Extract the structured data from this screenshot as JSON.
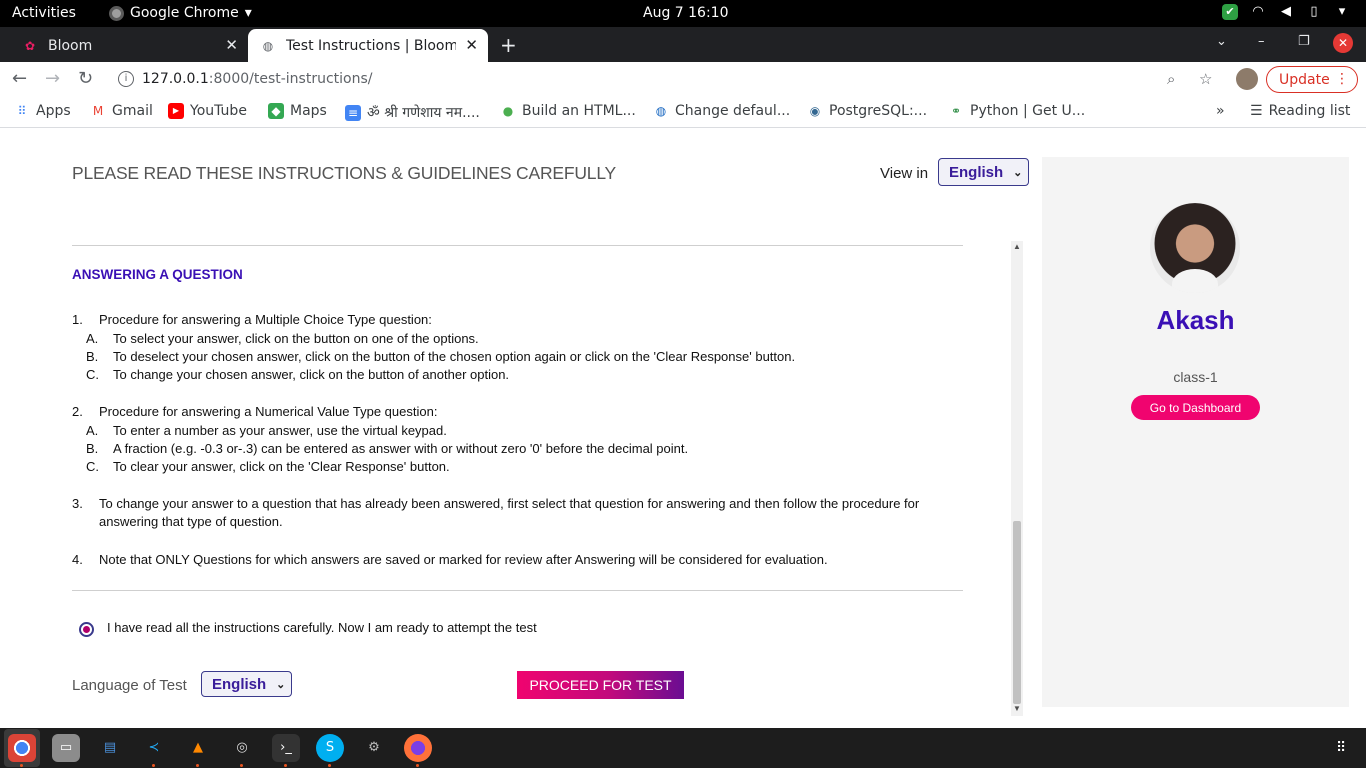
{
  "system": {
    "activities": "Activities",
    "app_name": "Google Chrome",
    "clock": "Aug 7  16:10"
  },
  "tabs": [
    {
      "title": "Bloom",
      "active": false
    },
    {
      "title": "Test Instructions | Bloom",
      "active": true
    }
  ],
  "address": {
    "host": "127.0.0.1",
    "path": ":8000/test-instructions/",
    "update_label": "Update"
  },
  "bookmarks": [
    {
      "label": "Apps",
      "icon": "apps-grid-icon"
    },
    {
      "label": "Gmail",
      "icon": "gmail-icon"
    },
    {
      "label": "YouTube",
      "icon": "youtube-icon"
    },
    {
      "label": "Maps",
      "icon": "maps-icon"
    },
    {
      "label": "ॐ श्री गणेशाय नम....",
      "icon": "docs-icon"
    },
    {
      "label": "Build an HTML...",
      "icon": "leaf-icon"
    },
    {
      "label": "Change defaul...",
      "icon": "globe-icon"
    },
    {
      "label": "PostgreSQL:...",
      "icon": "elephant-icon"
    },
    {
      "label": "Python | Get U...",
      "icon": "geeks-icon"
    }
  ],
  "reading_list": "Reading list",
  "page": {
    "heading": "PLEASE READ THESE INSTRUCTIONS & GUIDELINES CAREFULLY",
    "view_in_label": "View in",
    "view_in_value": "English",
    "section_title": "ANSWERING A QUESTION",
    "items": [
      {
        "num": "1.",
        "text": "Procedure for answering a Multiple Choice Type question:",
        "subs": [
          {
            "letter": "A.",
            "text": "To select your answer, click on the button on one of the options."
          },
          {
            "letter": "B.",
            "text": "To deselect your chosen answer, click on the button of the chosen option again or click on the 'Clear Response' button."
          },
          {
            "letter": "C.",
            "text": "To change your chosen answer, click on the button of another option."
          }
        ]
      },
      {
        "num": "2.",
        "text": "Procedure for answering a Numerical Value Type question:",
        "subs": [
          {
            "letter": "A.",
            "text": "To enter a number as your answer, use the virtual keypad."
          },
          {
            "letter": "B.",
            "text": "A fraction (e.g. -0.3 or-.3) can be entered as answer with or without zero '0' before the decimal point."
          },
          {
            "letter": "C.",
            "text": "To clear your answer, click on the 'Clear Response' button."
          }
        ]
      },
      {
        "num": "3.",
        "text": "To change your answer to a question that has already been answered, first select that question for answering and then follow the procedure for answering that type of question.",
        "subs": []
      },
      {
        "num": "4.",
        "text": "Note that ONLY Questions for which answers are saved or marked for review after Answering will be considered for evaluation.",
        "subs": []
      }
    ],
    "agree_text": "I have read all the instructions carefully. Now I am ready to attempt the test",
    "language_label": "Language of Test",
    "language_value": "English",
    "proceed_label": "PROCEED FOR TEST"
  },
  "profile": {
    "name": "Akash",
    "class": "class-1",
    "dashboard_label": "Go to Dashboard"
  },
  "colors": {
    "accent_purple": "#3a10b5",
    "accent_pink": "#f0046f"
  }
}
